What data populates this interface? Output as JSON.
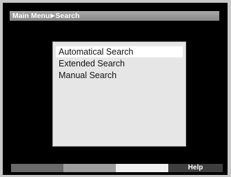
{
  "breadcrumb": {
    "root": "Main Menu",
    "separator_icon": "triangle-right-icon",
    "current": "Search"
  },
  "menu": {
    "items": [
      {
        "label": "Automatical Search",
        "selected": true
      },
      {
        "label": "Extended Search",
        "selected": false
      },
      {
        "label": "Manual Search",
        "selected": false
      }
    ]
  },
  "color_keys": {
    "red_label": "",
    "green_label": "",
    "yellow_label": "",
    "blue_label": "Help"
  },
  "colors": {
    "screen_background": "#000000",
    "menu_background": "#e6e6e6",
    "selection_highlight": "#ffffff"
  }
}
